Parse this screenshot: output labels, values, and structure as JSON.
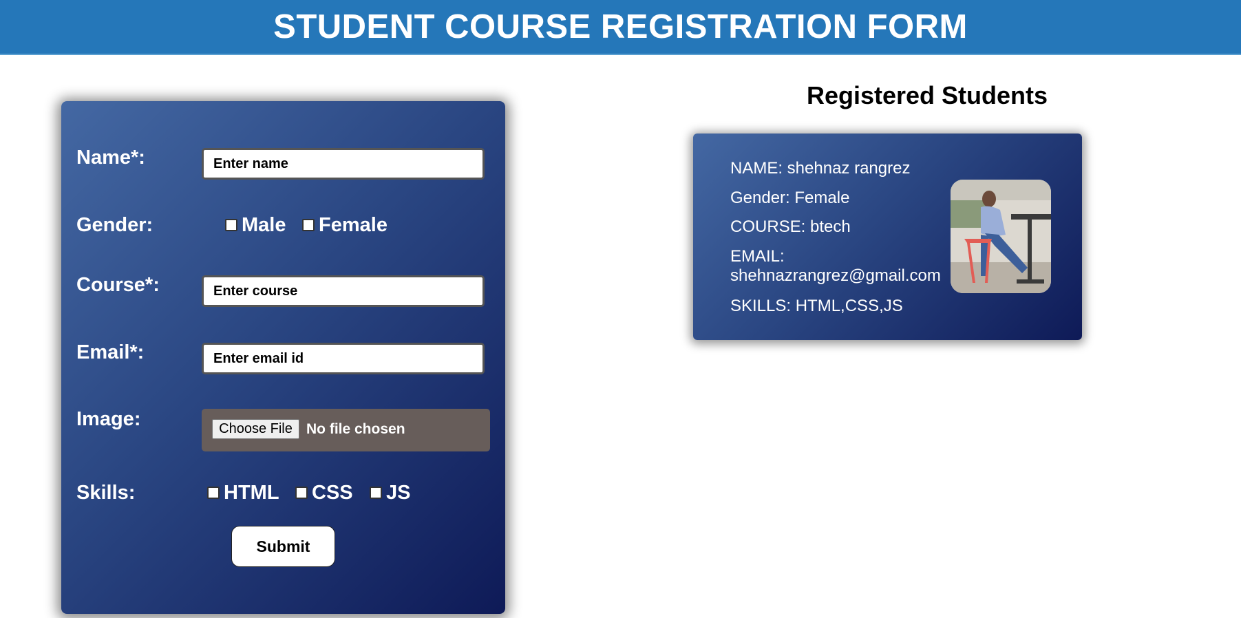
{
  "header": {
    "title": "STUDENT COURSE REGISTRATION FORM"
  },
  "form": {
    "name_label": "Name*:",
    "name_placeholder": "Enter name",
    "gender_label": "Gender:",
    "gender_options": [
      "Male",
      "Female"
    ],
    "course_label": "Course*:",
    "course_placeholder": "Enter course",
    "email_label": "Email*:",
    "email_placeholder": "Enter email id",
    "image_label": "Image:",
    "file_button_label": "Choose File",
    "file_status": "No file chosen",
    "skills_label": "Skills:",
    "skills_options": [
      "HTML",
      "CSS",
      "JS"
    ],
    "submit_label": "Submit"
  },
  "registered": {
    "title": "Registered Students",
    "students": [
      {
        "name_line": "NAME: shehnaz rangrez",
        "gender_line": "Gender: Female",
        "course_line": "COURSE: btech",
        "email_label": "EMAIL:",
        "email_value": "shehnazrangrez@gmail.com",
        "skills_line": "SKILLS: HTML,CSS,JS",
        "photo": "student-photo"
      }
    ]
  },
  "colors": {
    "header_bg": "#2577b9",
    "card_gradient_start": "#4468a3",
    "card_gradient_end": "#0e1a57",
    "file_box_bg": "#675d5a"
  }
}
